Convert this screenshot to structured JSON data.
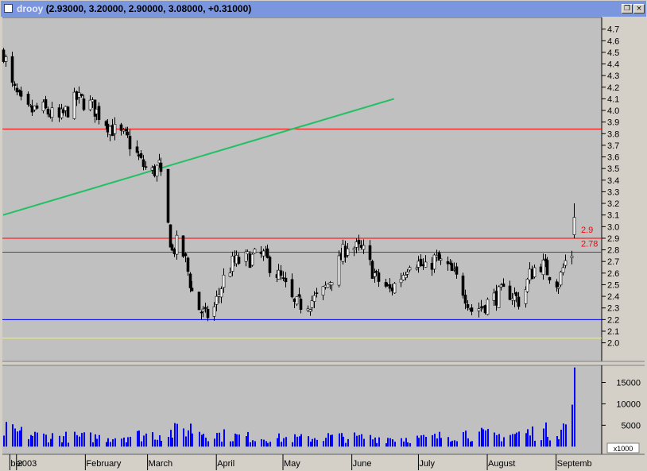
{
  "window": {
    "symbol": "drooy",
    "ohlc_text": "(2.93000, 3.20000, 2.90000, 3.08000, +0.31000)",
    "restore_glyph": "❐",
    "close_glyph": "×"
  },
  "colors": {
    "panel_bg": "#c0c0c0",
    "candle_up": "#ffffff",
    "candle_down": "#000000",
    "resistance_line": "#ff0000",
    "support_line": "#0000ff",
    "floor_line": "#ffff00",
    "trend_line": "#22c064",
    "volume_bar": "#0000ff"
  },
  "chart_data": [
    {
      "type": "candlestick",
      "title": "",
      "y_ticks": [
        "4.7",
        "4.6",
        "4.5",
        "4.4",
        "4.3",
        "4.2",
        "4.1",
        "4.0",
        "3.9",
        "3.8",
        "3.7",
        "3.6",
        "3.5",
        "3.4",
        "3.3",
        "3.2",
        "3.1",
        "3.0",
        "2.9",
        "2.8",
        "2.7",
        "2.6",
        "2.5",
        "2.4",
        "2.3",
        "2.2",
        "2.1",
        "2.0"
      ],
      "ylim": [
        1.84,
        4.8
      ],
      "x_range": [
        "2002-12-26",
        "2003-09-09"
      ],
      "x_labels": [
        {
          "text": "ber",
          "date": "2002-12-29"
        },
        {
          "text": "2003",
          "date": "2003-01-01"
        },
        {
          "text": "February",
          "date": "2003-02-01"
        },
        {
          "text": "March",
          "date": "2003-03-01"
        },
        {
          "text": "April",
          "date": "2003-04-01"
        },
        {
          "text": "May",
          "date": "2003-05-01"
        },
        {
          "text": "June",
          "date": "2003-06-01"
        },
        {
          "text": "July",
          "date": "2003-07-01"
        },
        {
          "text": "August",
          "date": "2003-08-01"
        },
        {
          "text": "Septemb",
          "date": "2003-09-01"
        }
      ],
      "close_path": [
        [
          "2002-12-26",
          4.5
        ],
        [
          "2002-12-30",
          4.2
        ],
        [
          "2003-01-05",
          3.98
        ],
        [
          "2003-01-12",
          4.02
        ],
        [
          "2003-01-20",
          3.92
        ],
        [
          "2003-01-28",
          4.1
        ],
        [
          "2003-02-03",
          4.05
        ],
        [
          "2003-02-08",
          3.95
        ],
        [
          "2003-02-14",
          3.82
        ],
        [
          "2003-02-20",
          3.75
        ],
        [
          "2003-02-26",
          3.55
        ],
        [
          "2003-03-02",
          3.45
        ],
        [
          "2003-03-06",
          3.52
        ],
        [
          "2003-03-08",
          3.28
        ],
        [
          "2003-03-10",
          3.0
        ],
        [
          "2003-03-12",
          2.78
        ],
        [
          "2003-03-15",
          2.88
        ],
        [
          "2003-03-18",
          2.7
        ],
        [
          "2003-03-22",
          2.35
        ],
        [
          "2003-03-27",
          2.22
        ],
        [
          "2003-03-31",
          2.3
        ],
        [
          "2003-04-04",
          2.55
        ],
        [
          "2003-04-08",
          2.68
        ],
        [
          "2003-04-14",
          2.72
        ],
        [
          "2003-04-22",
          2.75
        ],
        [
          "2003-04-30",
          2.55
        ],
        [
          "2003-05-06",
          2.32
        ],
        [
          "2003-05-12",
          2.35
        ],
        [
          "2003-05-18",
          2.4
        ],
        [
          "2003-05-25",
          2.65
        ],
        [
          "2003-05-30",
          2.85
        ],
        [
          "2003-06-06",
          2.78
        ],
        [
          "2003-06-12",
          2.55
        ],
        [
          "2003-06-18",
          2.45
        ],
        [
          "2003-06-24",
          2.6
        ],
        [
          "2003-06-28",
          2.75
        ],
        [
          "2003-07-04",
          2.62
        ],
        [
          "2003-07-08",
          2.72
        ],
        [
          "2003-07-14",
          2.65
        ],
        [
          "2003-07-20",
          2.5
        ],
        [
          "2003-07-25",
          2.28
        ],
        [
          "2003-07-30",
          2.32
        ],
        [
          "2003-08-05",
          2.4
        ],
        [
          "2003-08-10",
          2.45
        ],
        [
          "2003-08-16",
          2.35
        ],
        [
          "2003-08-20",
          2.58
        ],
        [
          "2003-08-24",
          2.7
        ],
        [
          "2003-08-28",
          2.62
        ],
        [
          "2003-09-02",
          2.52
        ],
        [
          "2003-09-05",
          2.7
        ],
        [
          "2003-09-08",
          2.77
        ],
        [
          "2003-09-09",
          3.08
        ]
      ],
      "last_candle": {
        "date": "2003-09-09",
        "open": 2.93,
        "high": 3.2,
        "low": 2.9,
        "close": 3.08
      },
      "horizontal_lines": [
        {
          "value": 3.84,
          "color": "#ff0000",
          "label": ""
        },
        {
          "value": 2.9,
          "color": "#ff0000",
          "label": "2.9"
        },
        {
          "value": 2.78,
          "color": "#ff0000",
          "label": "2.78"
        },
        {
          "value": 2.2,
          "color": "#0000ff",
          "label": ""
        },
        {
          "value": 2.04,
          "color": "#ffff00",
          "label": ""
        }
      ],
      "trend_line": {
        "from": [
          "2002-12-26",
          3.1
        ],
        "to": [
          "2003-06-20",
          4.1
        ],
        "color": "#22c064"
      }
    },
    {
      "type": "bar",
      "title": "",
      "y_ticks": [
        "15000",
        "10000",
        "5000"
      ],
      "ylim": [
        -1800,
        19000
      ],
      "units_label": "x1000",
      "volume_profile": [
        [
          "2002-12-26",
          4200
        ],
        [
          "2003-01-10",
          2800
        ],
        [
          "2003-01-25",
          2500
        ],
        [
          "2003-02-10",
          2400
        ],
        [
          "2003-02-25",
          3000
        ],
        [
          "2003-03-10",
          3500
        ],
        [
          "2003-03-20",
          4800
        ],
        [
          "2003-03-30",
          3200
        ],
        [
          "2003-04-10",
          2600
        ],
        [
          "2003-04-25",
          2200
        ],
        [
          "2003-05-10",
          2100
        ],
        [
          "2003-05-20",
          2600
        ],
        [
          "2003-06-05",
          2300
        ],
        [
          "2003-06-20",
          2200
        ],
        [
          "2003-07-05",
          2100
        ],
        [
          "2003-07-20",
          3500
        ],
        [
          "2003-08-05",
          2800
        ],
        [
          "2003-08-20",
          3600
        ],
        [
          "2003-09-01",
          4200
        ],
        [
          "2003-09-05",
          5200
        ],
        [
          "2003-09-08",
          9800
        ],
        [
          "2003-09-09",
          18500
        ]
      ]
    }
  ]
}
